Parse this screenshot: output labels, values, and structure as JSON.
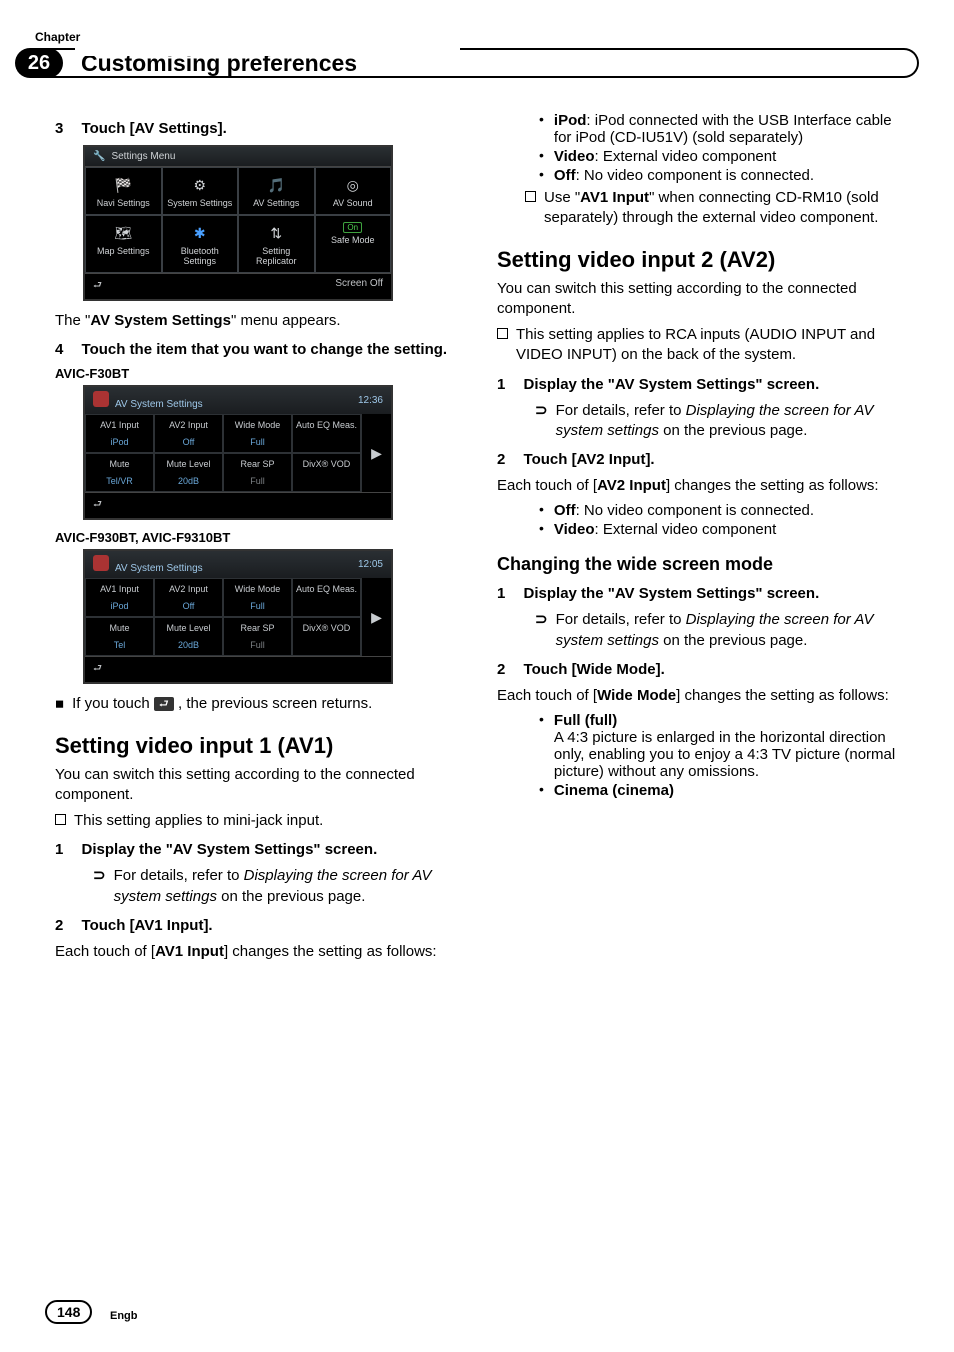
{
  "chapter": {
    "label": "Chapter",
    "number": "26",
    "title": "Customising preferences"
  },
  "page": {
    "number": "148",
    "locale": "Engb"
  },
  "left": {
    "step3": {
      "num": "3",
      "text": "Touch [AV Settings]."
    },
    "settings_menu": {
      "title": "Settings Menu",
      "cells": [
        "Navi Settings",
        "System Settings",
        "AV Settings",
        "AV Sound",
        "Map Settings",
        "Bluetooth Settings",
        "Setting Replicator",
        "Safe Mode"
      ],
      "foot_right": "Screen Off",
      "on": "On"
    },
    "after_menu": {
      "pre": "The \"",
      "bold": "AV System Settings",
      "post": "\" menu appears."
    },
    "step4": {
      "num": "4",
      "text": "Touch the item that you want to change the setting."
    },
    "model_a": "AVIC-F30BT",
    "av_a": {
      "title": "AV System Settings",
      "time": "12:36",
      "c": [
        {
          "t": "AV1 Input",
          "b": "iPod"
        },
        {
          "t": "AV2 Input",
          "b": "Off"
        },
        {
          "t": "Wide Mode",
          "b": "Full"
        },
        {
          "t": "Auto EQ Meas.",
          "b": ""
        },
        {
          "t": "Mute",
          "b": "Tel/VR"
        },
        {
          "t": "Mute Level",
          "b": "20dB"
        },
        {
          "t": "Rear SP",
          "b": "Full"
        },
        {
          "t": "DivX® VOD",
          "b": ""
        }
      ]
    },
    "model_b": "AVIC-F930BT, AVIC-F9310BT",
    "av_b": {
      "title": "AV System Settings",
      "time": "12:05",
      "c": [
        {
          "t": "AV1 Input",
          "b": "iPod"
        },
        {
          "t": "AV2 Input",
          "b": "Off"
        },
        {
          "t": "Wide Mode",
          "b": "Full"
        },
        {
          "t": "Auto EQ Meas.",
          "b": ""
        },
        {
          "t": "Mute",
          "b": "Tel"
        },
        {
          "t": "Mute Level",
          "b": "20dB"
        },
        {
          "t": "Rear SP",
          "b": "Full"
        },
        {
          "t": "DivX® VOD",
          "b": ""
        }
      ]
    },
    "back_note": {
      "pre": "If you touch ",
      "post": ", the previous screen returns."
    },
    "h2_av1": "Setting video input 1 (AV1)",
    "av1_intro": "You can switch this setting according to the connected component.",
    "av1_note": "This setting applies to mini-jack input.",
    "av1_s1": {
      "num": "1",
      "text": "Display the \"AV System Settings\" screen."
    },
    "av1_ref": {
      "pre": "For details, refer to ",
      "ital": "Displaying the screen for AV system settings",
      "post": " on the previous page."
    },
    "av1_s2": {
      "num": "2",
      "text": "Touch [AV1 Input]."
    },
    "av1_each": {
      "pre": "Each touch of [",
      "bold": "AV1 Input",
      "post": "] changes the setting as follows:"
    }
  },
  "right": {
    "items": [
      {
        "bold": "iPod",
        "text": ": iPod connected with the USB Interface cable for iPod (CD-IU51V) (sold separately)"
      },
      {
        "bold": "Video",
        "text": ": External video component"
      },
      {
        "bold": "Off",
        "text": ": No video component is connected."
      }
    ],
    "use_note": {
      "pre": "Use \"",
      "bold": "AV1 Input",
      "post": "\" when connecting CD-RM10 (sold separately) through the external video component."
    },
    "h2_av2": "Setting video input 2 (AV2)",
    "av2_intro": "You can switch this setting according to the connected component.",
    "av2_note": "This setting applies to RCA inputs (AUDIO INPUT and VIDEO INPUT) on the back of the system.",
    "av2_s1": {
      "num": "1",
      "text": "Display the \"AV System Settings\" screen."
    },
    "av2_ref": {
      "pre": "For details, refer to ",
      "ital": "Displaying the screen for AV system settings",
      "post": " on the previous page."
    },
    "av2_s2": {
      "num": "2",
      "text": "Touch [AV2 Input]."
    },
    "av2_each": {
      "pre": "Each touch of [",
      "bold": "AV2 Input",
      "post": "] changes the setting as follows:"
    },
    "av2_items": [
      {
        "bold": "Off",
        "text": ": No video component is connected."
      },
      {
        "bold": "Video",
        "text": ": External video component"
      }
    ],
    "h3_wide": "Changing the wide screen mode",
    "wide_s1": {
      "num": "1",
      "text": "Display the \"AV System Settings\" screen."
    },
    "wide_ref": {
      "pre": "For details, refer to ",
      "ital": "Displaying the screen for AV system settings",
      "post": " on the previous page."
    },
    "wide_s2": {
      "num": "2",
      "text": "Touch [Wide Mode]."
    },
    "wide_each": {
      "pre": "Each touch of [",
      "bold": "Wide Mode",
      "post": "] changes the setting as follows:"
    },
    "wide_full": {
      "head": "Full (full)",
      "body": "A 4:3 picture is enlarged in the horizontal direction only, enabling you to enjoy a 4:3 TV picture (normal picture) without any omissions."
    },
    "wide_cinema": {
      "head": "Cinema (cinema)"
    }
  }
}
